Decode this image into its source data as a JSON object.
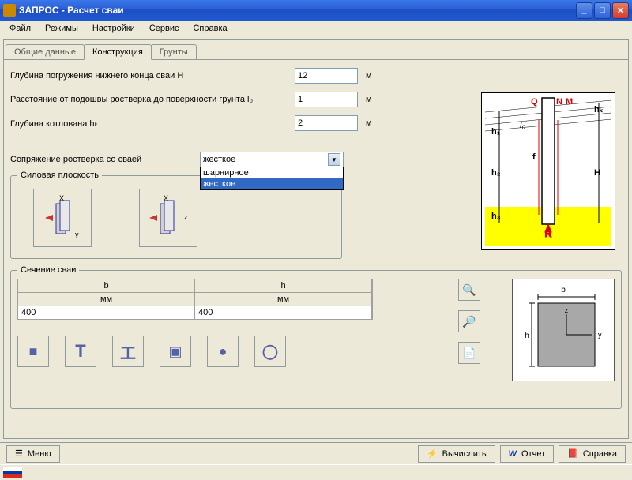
{
  "window": {
    "title": "ЗАПРОС - Расчет сваи"
  },
  "menubar": {
    "items": [
      "Файл",
      "Режимы",
      "Настройки",
      "Сервис",
      "Справка"
    ]
  },
  "tabs": {
    "items": [
      "Общие данные",
      "Конструкция",
      "Грунты"
    ],
    "active": 1
  },
  "form": {
    "depth_label": "Глубина погружения нижнего конца сваи H",
    "depth_value": "12",
    "depth_unit": "м",
    "dist_label": "Расстояние от подошвы ростверка до поверхности грунта l₀",
    "dist_value": "1",
    "dist_unit": "м",
    "pit_label": "Глубина котлована hₖ",
    "pit_value": "2",
    "pit_unit": "м",
    "joint_label": "Сопряжение ростверка со сваей",
    "joint_value": "жесткое",
    "joint_options": [
      "шарнирное",
      "жесткое"
    ]
  },
  "force_plane": {
    "title": "Силовая плоскость"
  },
  "section": {
    "title": "Сечение сваи",
    "col_b": "b",
    "col_h": "h",
    "unit_b": "мм",
    "unit_h": "мм",
    "val_b": "400",
    "val_h": "400"
  },
  "bottombar": {
    "menu": "Меню",
    "calc": "Вычислить",
    "report": "Отчет",
    "help": "Справка"
  },
  "icons": {
    "minimize": "_",
    "maximize": "□",
    "close": "✕",
    "dd_arrow": "▼",
    "square": "■",
    "tee": "T",
    "ibeam": "工",
    "boxhole": "▣",
    "solidcircle": "●",
    "ring": "◯",
    "zoom": "🔍",
    "zoom2": "🔎",
    "doc": "📄",
    "bolt": "⚡",
    "reporticon": "W",
    "helpicon": "📕",
    "menulist": "☰"
  }
}
